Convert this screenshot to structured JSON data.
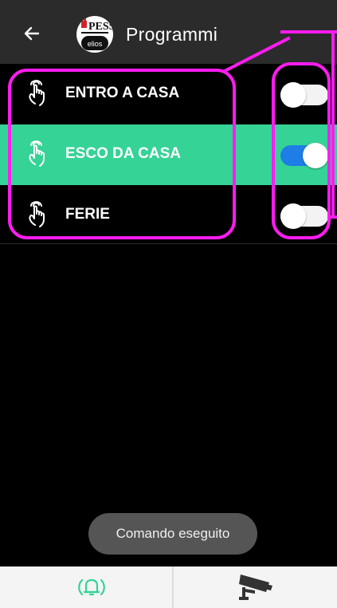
{
  "appbar": {
    "title": "Programmi",
    "logo_text": "PESS",
    "logo_subtext": "elios"
  },
  "programs": [
    {
      "label": "ENTRO A CASA",
      "enabled": false,
      "selected": false
    },
    {
      "label": "ESCO DA CASA",
      "enabled": true,
      "selected": true
    },
    {
      "label": "FERIE",
      "enabled": false,
      "selected": false
    }
  ],
  "toast": "Comando eseguito",
  "bottom_nav": [
    {
      "icon": "alarm-bell-icon",
      "color": "#35d396"
    },
    {
      "icon": "security-camera-icon",
      "color": "#333333"
    }
  ],
  "colors": {
    "accent": "#35d396",
    "toggle_on": "#1f7de6",
    "highlight": "#ff1cf0",
    "appbar": "#2b2b2b"
  }
}
